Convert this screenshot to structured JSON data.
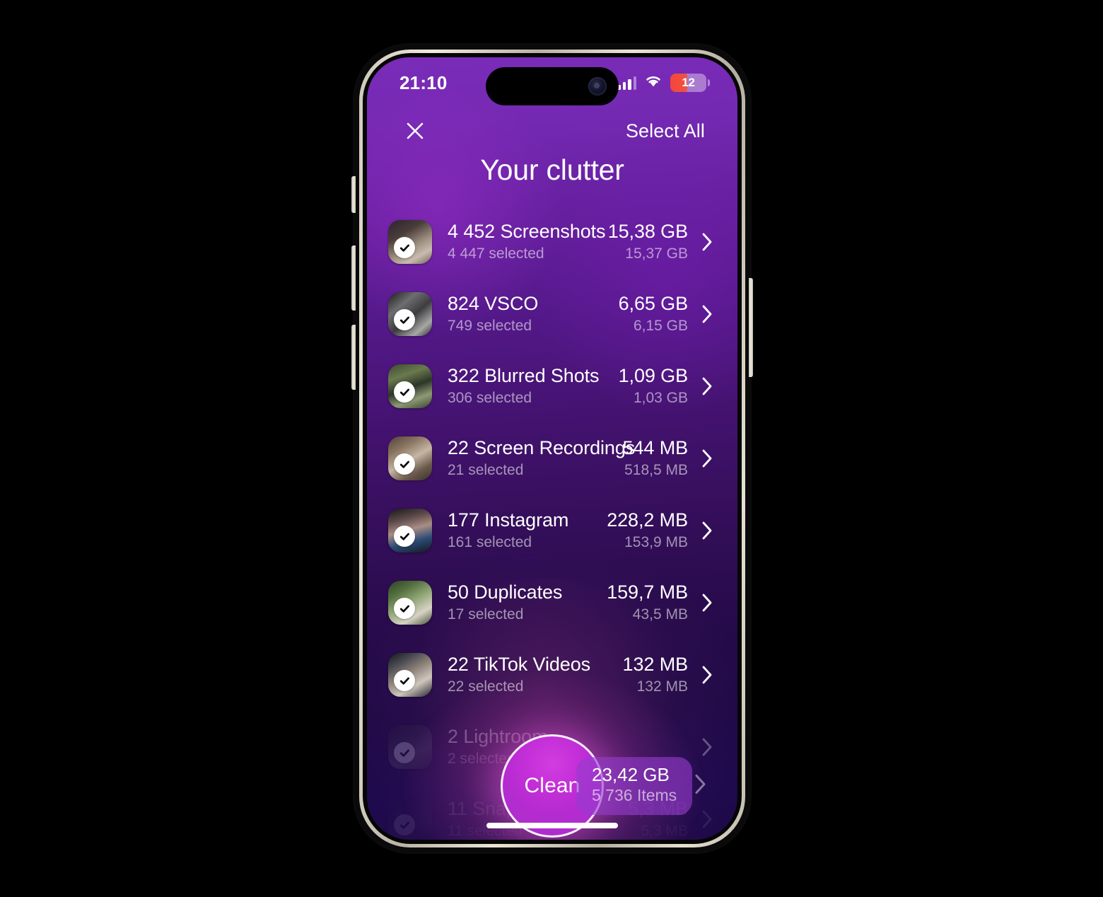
{
  "statusbar": {
    "time": "21:10",
    "cellular_icon": "cellular-bars-icon",
    "wifi_icon": "wifi-icon",
    "battery_icon": "battery-icon",
    "battery_level": "12"
  },
  "nav": {
    "close_icon": "close-icon",
    "select_all_label": "Select All"
  },
  "header": {
    "title": "Your clutter"
  },
  "list": {
    "rows": [
      {
        "title": "4 452 Screenshots",
        "subtitle": "4 447 selected",
        "size": "15,38 GB",
        "size_selected": "15,37 GB",
        "checked": true,
        "state": "normal",
        "thumb": "photo-thumbnail"
      },
      {
        "title": "824 VSCO",
        "subtitle": "749 selected",
        "size": "6,65 GB",
        "size_selected": "6,15 GB",
        "checked": true,
        "state": "normal",
        "thumb": "photo-thumbnail"
      },
      {
        "title": "322 Blurred Shots",
        "subtitle": "306 selected",
        "size": "1,09 GB",
        "size_selected": "1,03 GB",
        "checked": true,
        "state": "normal",
        "thumb": "photo-thumbnail"
      },
      {
        "title": "22 Screen Recordings",
        "subtitle": "21 selected",
        "size": "544 MB",
        "size_selected": "518,5 MB",
        "checked": true,
        "state": "normal",
        "thumb": "photo-thumbnail"
      },
      {
        "title": "177 Instagram",
        "subtitle": "161 selected",
        "size": "228,2 MB",
        "size_selected": "153,9 MB",
        "checked": true,
        "state": "normal",
        "thumb": "photo-thumbnail"
      },
      {
        "title": "50 Duplicates",
        "subtitle": "17 selected",
        "size": "159,7 MB",
        "size_selected": "43,5 MB",
        "checked": true,
        "state": "normal",
        "thumb": "photo-thumbnail"
      },
      {
        "title": "22 TikTok Videos",
        "subtitle": "22 selected",
        "size": "132 MB",
        "size_selected": "132 MB",
        "checked": true,
        "state": "normal",
        "thumb": "photo-thumbnail"
      },
      {
        "title": "2 Lightroom",
        "subtitle": "2 selected",
        "size": "",
        "size_selected": "",
        "checked": true,
        "state": "dimmed",
        "thumb": "photo-thumbnail"
      },
      {
        "title": "11 Snapchat",
        "subtitle": "11 selected",
        "size": "5,3 MB",
        "size_selected": "5,3 MB",
        "checked": true,
        "state": "faded",
        "thumb": "photo-thumbnail"
      }
    ],
    "chevron_icon": "chevron-right-icon",
    "check_icon": "check-icon"
  },
  "clean": {
    "button_label": "Clean",
    "total_size": "23,42 GB",
    "total_items": "5 736 Items",
    "summary_chevron_icon": "chevron-right-icon"
  },
  "system": {
    "home_indicator": "home-indicator",
    "dynamic_island": "dynamic-island",
    "camera_icon": "front-camera-icon"
  },
  "colors": {
    "accent_magenta": "#C42FD8",
    "bg_top": "#7A2CB8",
    "bg_bottom": "#17064A",
    "battery_low": "#F5443C",
    "summary_bg": "#963CCD"
  }
}
